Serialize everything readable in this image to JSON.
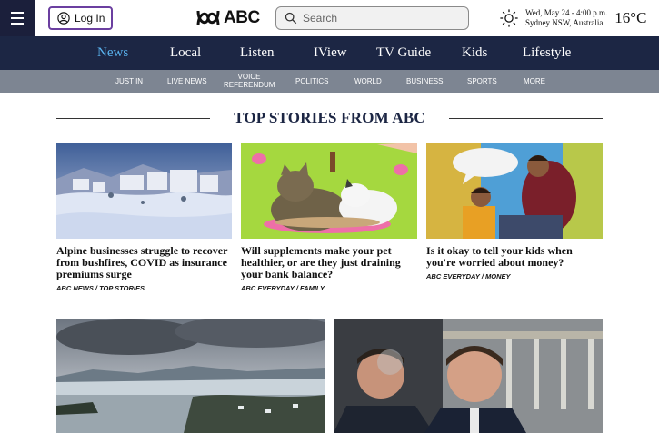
{
  "header": {
    "login_label": "Log In",
    "logo_text": "ABC",
    "search_placeholder": "Search",
    "weather": {
      "date": "Wed, May 24 - 4:00 p.m.",
      "location": "Sydney NSW, Australia",
      "temperature": "16°C",
      "icon": "sun-icon"
    }
  },
  "main_nav": {
    "items": [
      {
        "label": "News",
        "active": true
      },
      {
        "label": "Local"
      },
      {
        "label": "Listen"
      },
      {
        "label": "IView"
      },
      {
        "label": "TV Guide"
      },
      {
        "label": "Kids"
      },
      {
        "label": "Lifestyle"
      }
    ]
  },
  "sub_nav": {
    "items": [
      {
        "label": "JUST IN"
      },
      {
        "label": "LIVE NEWS"
      },
      {
        "label": "VOICE REFERENDUM"
      },
      {
        "label": "POLITICS"
      },
      {
        "label": "WORLD"
      },
      {
        "label": "BUSINESS"
      },
      {
        "label": "SPORTS"
      },
      {
        "label": "MORE"
      }
    ]
  },
  "section": {
    "title": "TOP STORIES FROM ABC"
  },
  "stories": [
    {
      "headline": "Alpine businesses struggle to recover from bushfires, COVID as insurance premiums surge",
      "tag": "ABC NEWS / TOP STORIES"
    },
    {
      "headline": "Will supplements make your pet healthier, or are they just draining your bank balance?",
      "tag": "ABC EVERYDAY / FAMILY"
    },
    {
      "headline": "Is it okay to tell your kids when you're worried about money?",
      "tag": "ABC EVERYDAY / MONEY"
    }
  ],
  "colors": {
    "brand_dark": "#1c2644",
    "menu_bg": "#1b1f3b",
    "active_nav": "#5ab4f0",
    "subnav_bg": "#7d8592",
    "login_border": "#6b3fa0"
  }
}
